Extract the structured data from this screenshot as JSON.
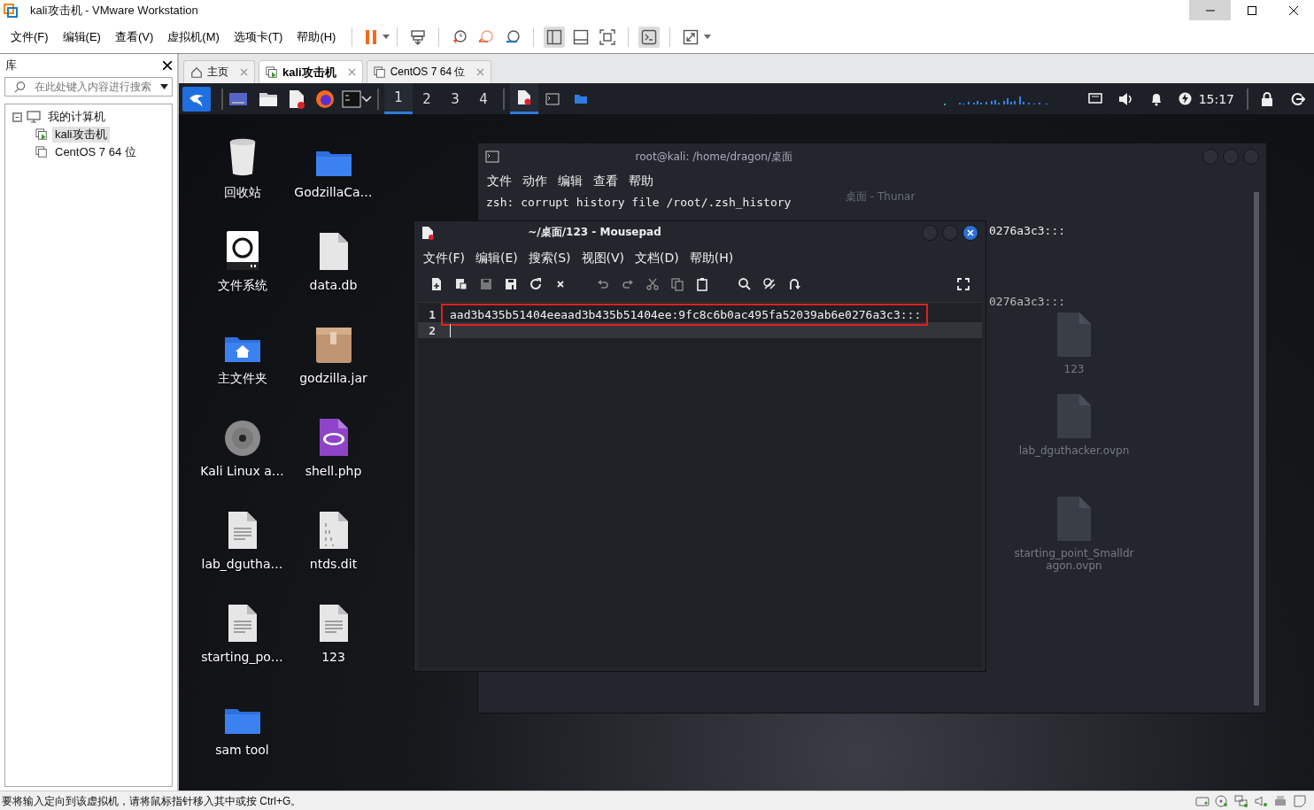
{
  "window": {
    "title": "kali攻击机 - VMware Workstation"
  },
  "menu": [
    "文件(F)",
    "编辑(E)",
    "查看(V)",
    "虚拟机(M)",
    "选项卡(T)",
    "帮助(H)"
  ],
  "library": {
    "title": "库",
    "search_placeholder": "在此处键入内容进行搜索",
    "tree": [
      {
        "label": "我的计算机",
        "expanded": true,
        "selected": false,
        "children": [
          {
            "label": "kali攻击机",
            "running": true,
            "selected": true
          },
          {
            "label": "CentOS 7 64 位",
            "running": false,
            "selected": false
          }
        ]
      }
    ]
  },
  "tabs": [
    {
      "label": "主页",
      "kind": "home",
      "selected": false
    },
    {
      "label": "kali攻击机",
      "kind": "vm-running",
      "selected": true
    },
    {
      "label": "CentOS 7 64 位",
      "kind": "vm",
      "selected": false
    }
  ],
  "kali_panel": {
    "workspaces": [
      {
        "label": "1",
        "selected": true
      },
      {
        "label": "2",
        "selected": false
      },
      {
        "label": "3",
        "selected": false
      },
      {
        "label": "4",
        "selected": false
      }
    ],
    "clock": "15:17"
  },
  "desktop_icons": [
    {
      "label": "回收站",
      "kind": "trash"
    },
    {
      "label": "GodzillaCa…",
      "kind": "folder"
    },
    {
      "label": "文件系统",
      "kind": "drive"
    },
    {
      "label": "data.db",
      "kind": "file"
    },
    {
      "label": "主文件夹",
      "kind": "home-folder"
    },
    {
      "label": "godzilla.jar",
      "kind": "package"
    },
    {
      "label": "Kali Linux a…",
      "kind": "disc"
    },
    {
      "label": "shell.php",
      "kind": "php"
    },
    {
      "label": "lab_dgutha…",
      "kind": "text"
    },
    {
      "label": "ntds.dit",
      "kind": "binary"
    },
    {
      "label": "starting_po…",
      "kind": "text"
    },
    {
      "label": "123",
      "kind": "text"
    },
    {
      "label": "sam tool",
      "kind": "folder"
    }
  ],
  "terminal": {
    "title": "root@kali: /home/dragon/桌面",
    "menu": [
      "文件",
      "动作",
      "编辑",
      "查看",
      "帮助"
    ],
    "lines": [
      "zsh: corrupt history file /root/.zsh_history"
    ],
    "side_lines": [
      "0276a3c3:::",
      "0276a3c3:::"
    ],
    "ghost": {
      "title": "桌面 - Thunar",
      "files": [
        "123",
        "lab_dguthacker.ovpn",
        "starting_point_Smalldragon.ovpn"
      ]
    }
  },
  "mousepad": {
    "title": "~/桌面/123 - Mousepad",
    "menu": [
      "文件(F)",
      "编辑(E)",
      "搜索(S)",
      "视图(V)",
      "文档(D)",
      "帮助(H)"
    ],
    "lines": [
      {
        "number": "1",
        "text": "aad3b435b51404eeaad3b435b51404ee:9fc8c6b0ac495fa52039ab6e0276a3c3:::",
        "marked": true,
        "current": false
      },
      {
        "number": "2",
        "marked": false,
        "current": true
      }
    ]
  },
  "status_bar": {
    "message": "要将输入定向到该虚拟机，请将鼠标指针移入其中或按 Ctrl+G。"
  }
}
